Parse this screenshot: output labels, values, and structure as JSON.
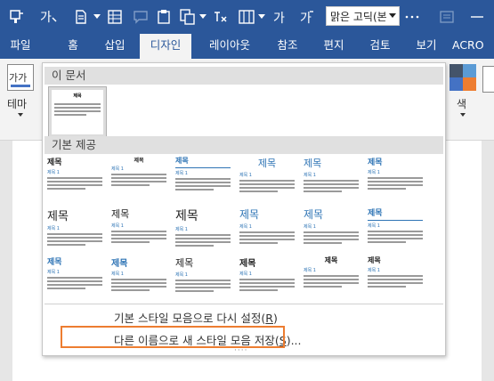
{
  "qat": {
    "font_name": "맑은 고딕(본"
  },
  "tabs": [
    {
      "label": "파일"
    },
    {
      "label": "홈"
    },
    {
      "label": "삽입"
    },
    {
      "label": "디자인"
    },
    {
      "label": "레이아웃"
    },
    {
      "label": "참조"
    },
    {
      "label": "편지"
    },
    {
      "label": "검토"
    },
    {
      "label": "보기"
    },
    {
      "label": "ACRO"
    }
  ],
  "ribbon": {
    "theme_label": "테마",
    "theme_icon_text": "가가",
    "color_label": "색"
  },
  "gallery": {
    "this_document_header": "이 문서",
    "builtin_header": "기본 제공",
    "sample_title": "제목",
    "sample_heading": "제목 1",
    "reset_label": "기본 스타일 모음으로 다시 설정",
    "reset_key": "R",
    "save_label": "다른 이름으로 새 스타일 모음 저장",
    "save_key": "S",
    "grip": "····"
  },
  "colors": {
    "brand": "#2b579a",
    "highlight": "#ed7d31",
    "heading_blue": "#2e74b5"
  }
}
